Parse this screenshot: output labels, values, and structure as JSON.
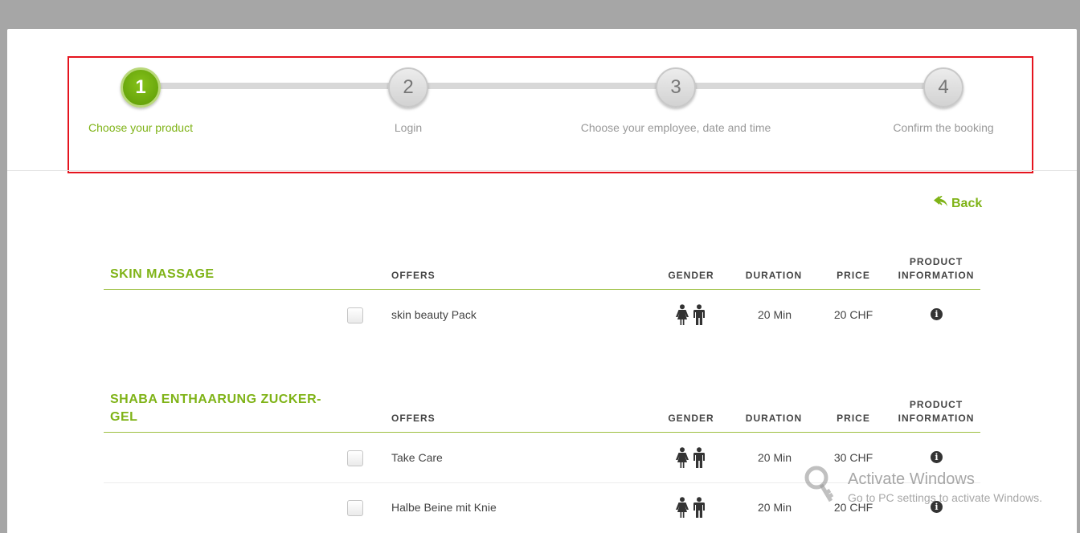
{
  "stepper": {
    "steps": [
      {
        "number": "1",
        "label": "Choose your product",
        "active": true
      },
      {
        "number": "2",
        "label": "Login",
        "active": false
      },
      {
        "number": "3",
        "label": "Choose your employee, date and time",
        "active": false
      },
      {
        "number": "4",
        "label": "Confirm the booking",
        "active": false
      }
    ]
  },
  "back_label": "Back",
  "columns": {
    "offers": "OFFERS",
    "gender": "GENDER",
    "duration": "DURATION",
    "price": "PRICE",
    "product_info_line1": "PRODUCT",
    "product_info_line2": "INFORMATION"
  },
  "sections": [
    {
      "title": "SKIN MASSAGE",
      "rows": [
        {
          "offer": "skin beauty Pack",
          "duration": "20 Min",
          "price": "20 CHF"
        }
      ]
    },
    {
      "title_line1": "SHABA ENTHAARUNG ZUCKER-",
      "title_line2": "GEL",
      "rows": [
        {
          "offer": "Take Care",
          "duration": "20 Min",
          "price": "30 CHF"
        },
        {
          "offer": "Halbe Beine mit Knie",
          "duration": "20 Min",
          "price": "20 CHF"
        }
      ]
    }
  ],
  "icons": {
    "back": "reply-arrow-icon",
    "gender_female": "female-icon",
    "gender_male": "male-icon",
    "info": "info-icon",
    "watermark": "key-icon"
  },
  "colors": {
    "accent": "#7fb317",
    "highlight_frame": "#e5141e"
  },
  "watermark": {
    "title": "Activate Windows",
    "subtitle": "Go to PC settings to activate Windows."
  }
}
